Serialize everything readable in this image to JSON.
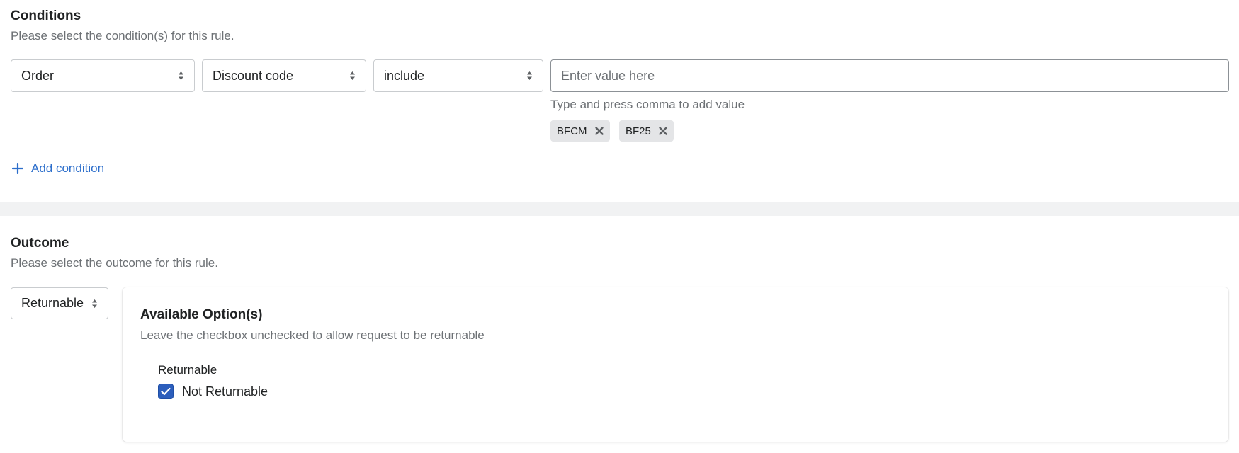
{
  "conditions": {
    "title": "Conditions",
    "subtitle": "Please select the condition(s) for this rule.",
    "row": {
      "subject_select": "Order",
      "field_select": "Discount code",
      "operator_select": "include",
      "value_placeholder": "Enter value here",
      "value": "",
      "help_text": "Type and press comma to add value",
      "tags": [
        "BFCM",
        "BF25"
      ]
    },
    "add_condition_label": "Add condition"
  },
  "outcome": {
    "title": "Outcome",
    "subtitle": "Please select the outcome for this rule.",
    "select_value": "Returnable",
    "options_card": {
      "title": "Available Option(s)",
      "subtitle": "Leave the checkbox unchecked to allow request to be returnable",
      "group_label": "Returnable",
      "checkbox_label": "Not Returnable",
      "checkbox_checked": true
    }
  },
  "colors": {
    "link": "#2c6ecb",
    "checkbox_fill": "#2c5ebc",
    "muted_text": "#6d7175",
    "divider_band": "#f1f2f3"
  },
  "icons": {
    "select_arrows": "up-down-caret-icon",
    "tag_remove": "close-icon",
    "add": "plus-icon",
    "check": "checkmark-icon"
  }
}
